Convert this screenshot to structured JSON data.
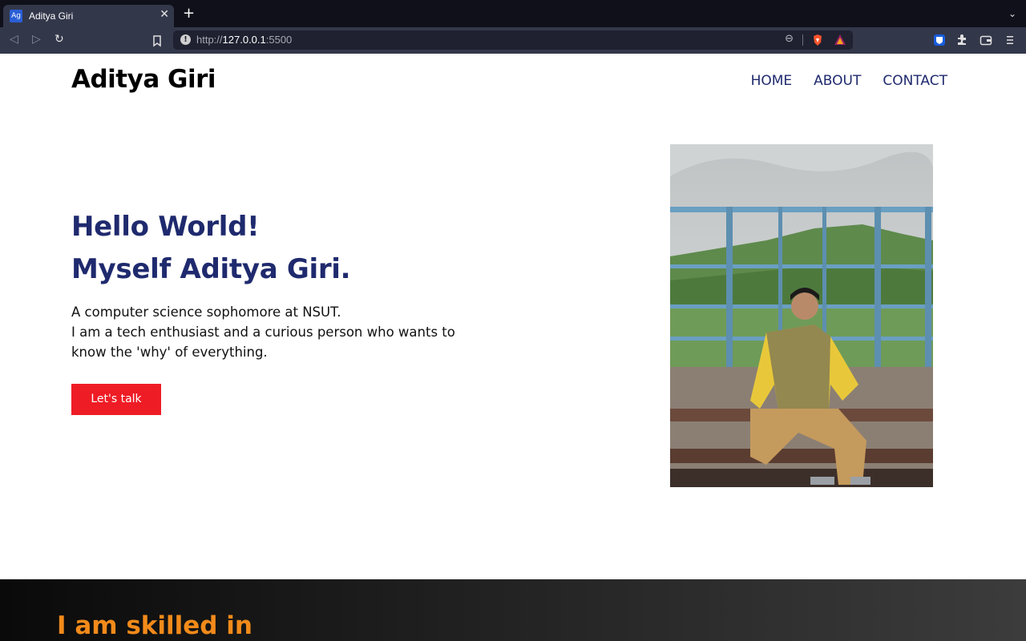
{
  "browser": {
    "tab": {
      "title": "Aditya Giri",
      "favicon_text": "Ag"
    },
    "url": {
      "scheme": "http://",
      "host": "127.0.0.1",
      "port": ":5500"
    },
    "icons": {
      "back": "arrow-left-icon",
      "forward": "arrow-right-icon",
      "reload": "reload-icon",
      "bookmark": "bookmark-icon",
      "site_info": "info-icon",
      "zoom": "zoom-icon",
      "brave_shield": "brave-shield-icon",
      "brave_rewards": "brave-rewards-icon",
      "bitwarden": "bitwarden-icon",
      "extensions": "puzzle-icon",
      "wallet": "wallet-icon",
      "menu": "hamburger-icon"
    }
  },
  "header": {
    "brand": "Aditya Giri",
    "nav": [
      {
        "label": "HOME"
      },
      {
        "label": "ABOUT"
      },
      {
        "label": "CONTACT"
      }
    ]
  },
  "hero": {
    "title_line1": "Hello World!",
    "title_line2": "Myself Aditya Giri.",
    "text_line1": "A computer science sophomore at NSUT.",
    "text_line2": "I am a tech enthusiast and a curious person who wants to know the 'why' of everything.",
    "cta_label": "Let's talk"
  },
  "skills": {
    "title": "I am skilled in"
  },
  "colors": {
    "navy": "#1f2a6e",
    "cta_red": "#ee1c25",
    "skills_orange": "#f28a1a",
    "chrome_dark": "#0f101a",
    "chrome_toolbar": "#33374a"
  }
}
